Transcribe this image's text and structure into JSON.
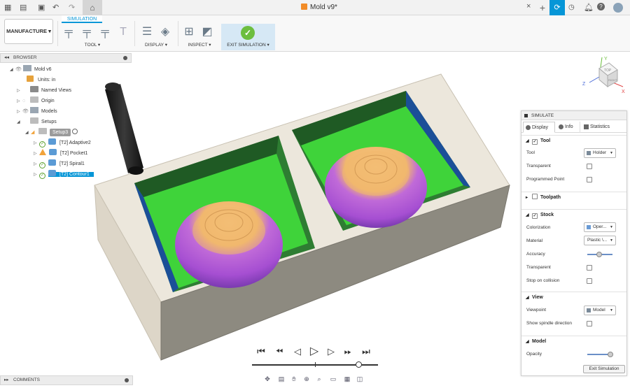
{
  "title_bar": {
    "document_title": "Mold v9*",
    "close_glyph": "×",
    "add_tab_glyph": "+",
    "icons": [
      "grid-menu-icon",
      "file-icon",
      "save-icon",
      "undo-icon",
      "redo-icon",
      "home-icon",
      "help-icon",
      "notifications-icon",
      "avatar"
    ]
  },
  "ribbon": {
    "active_tab": "SIMULATION",
    "workspace": "MANUFACTURE",
    "groups": {
      "tool": "TOOL",
      "display": "DISPLAY",
      "inspect": "INSPECT",
      "exit": "EXIT SIMULATION"
    }
  },
  "browser": {
    "header": "BROWSER",
    "items": [
      {
        "label": "Mold v6"
      },
      {
        "label": "Units: in"
      },
      {
        "label": "Named Views"
      },
      {
        "label": "Origin"
      },
      {
        "label": "Models"
      },
      {
        "label": "Setups"
      },
      {
        "label": "Setup3"
      },
      {
        "label": "[T2] Adaptive2"
      },
      {
        "label": "[T2] Pocket1"
      },
      {
        "label": "[T2] Spiral1"
      },
      {
        "label": "[T2] Contour1"
      }
    ]
  },
  "comments": {
    "label": "COMMENTS"
  },
  "viewcube": {
    "top": "TOP",
    "right": "RIGHT",
    "axes": [
      "X",
      "Y",
      "Z"
    ]
  },
  "simulate_panel": {
    "title": "SIMULATE",
    "tabs": [
      "Display",
      "Info",
      "Statistics"
    ],
    "sections": {
      "tool": {
        "title": "Tool",
        "tool_label": "Tool",
        "tool_value": "Holder",
        "transparent": "Transparent",
        "programmed_point": "Programmed Point"
      },
      "toolpath": {
        "title": "Toolpath"
      },
      "stock": {
        "title": "Stock",
        "colorization": "Colorization",
        "colorization_value": "Oper...",
        "material": "Material",
        "material_value": "Plastic \\...",
        "accuracy": "Accuracy",
        "transparent": "Transparent",
        "stop_on_collision": "Stop on collision"
      },
      "view": {
        "title": "View",
        "viewpoint": "Viewpoint",
        "viewpoint_value": "Model",
        "show_spindle": "Show spindle direction"
      },
      "model": {
        "title": "Model",
        "opacity": "Opacity"
      }
    },
    "exit_button": "Exit Simulation",
    "accuracy_level": 0.35,
    "opacity_level": 0.8
  },
  "playback": {
    "controls": [
      "skip-start",
      "previous-move",
      "step-back",
      "play",
      "step-forward",
      "next-move",
      "skip-end"
    ],
    "progress": 0.82
  },
  "colors": {
    "accent": "#0696d7",
    "stock": "#ece7dc",
    "cavity_floor": "#3fd33a",
    "cavity_wall": "#2a8a32",
    "dome_top": "#f1b86e",
    "dome_side": "#a64fd2",
    "tool": "#222222"
  }
}
